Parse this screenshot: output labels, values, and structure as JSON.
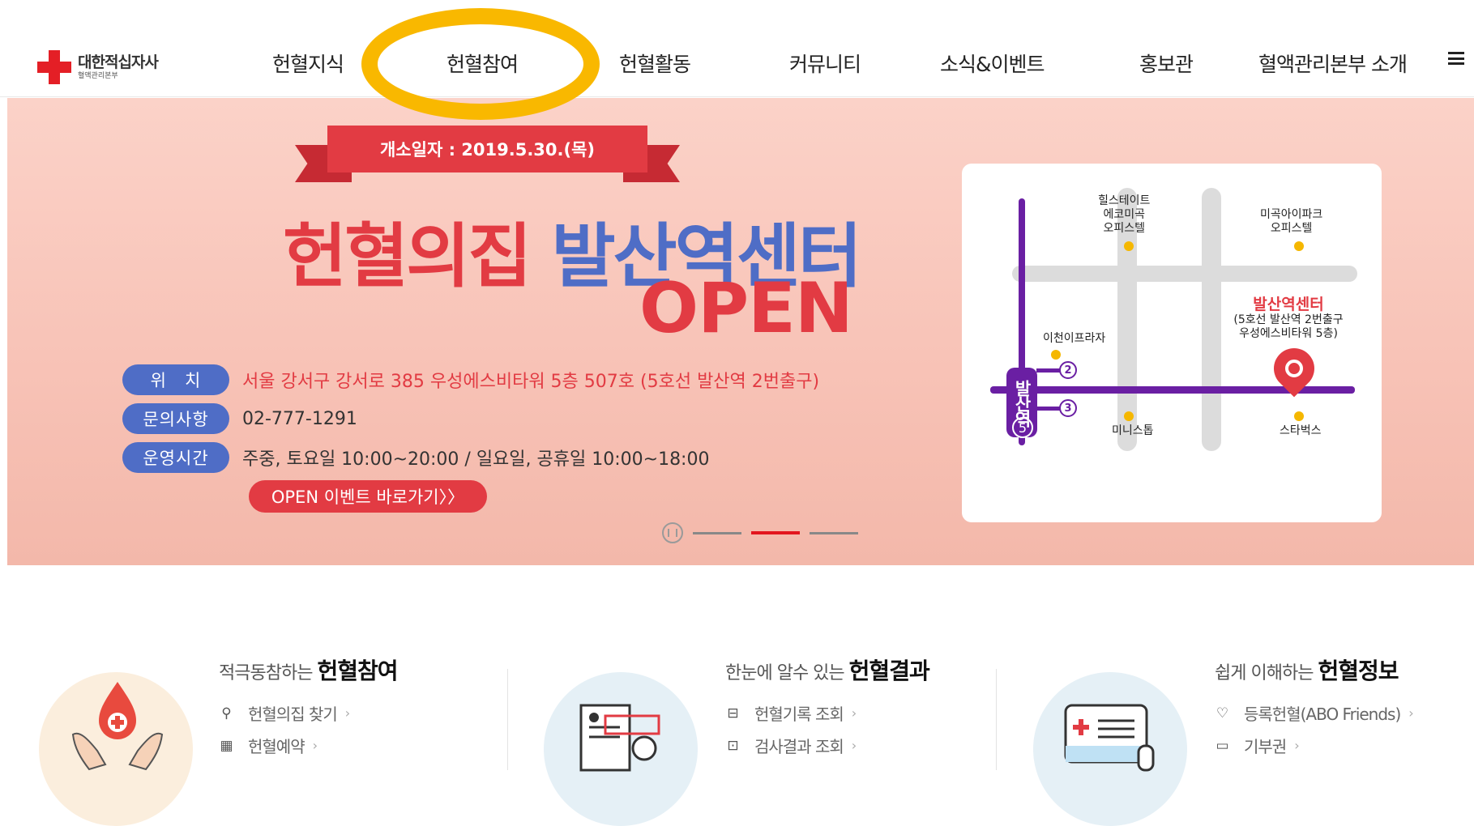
{
  "header": {
    "logo": {
      "main": "대한적십자사",
      "sub": "혈액관리본부"
    },
    "nav": [
      {
        "label": "헌혈지식"
      },
      {
        "label": "헌혈참여"
      },
      {
        "label": "헌혈활동"
      },
      {
        "label": "커뮤니티"
      },
      {
        "label": "소식&이벤트"
      },
      {
        "label": "홍보관"
      },
      {
        "label": "혈액관리본부 소개"
      }
    ],
    "highlighted_nav": "헌혈참여",
    "highlight_color": "#f9b800"
  },
  "banner": {
    "ribbon": "개소일자 : 2019.5.30.(목)",
    "headline_red": "헌혈의집",
    "headline_blue": "발산역센터",
    "open": "OPEN",
    "info": [
      {
        "label": "위　치",
        "value": "서울 강서구 강서로 385 우성에스비타워 5층 507호 (5호선 발산역 2번출구)"
      },
      {
        "label": "문의사항",
        "value": "02-777-1291"
      },
      {
        "label": "운영시간",
        "value": "주중, 토요일 10:00~20:00 / 일요일, 공휴일 10:00~18:00"
      }
    ],
    "event_button": "OPEN 이벤트 바로가기〉〉",
    "slider": {
      "total": 3,
      "active": 2
    },
    "colors": {
      "red": "#e23b43",
      "blue": "#4f6dc6",
      "metro": "#6a1fa3"
    },
    "map": {
      "pois": [
        {
          "label": "힐스테이트\n에코미곡\n오피스텔"
        },
        {
          "label": "미곡아이파크\n오피스텔"
        },
        {
          "label": "이천이프라자"
        },
        {
          "label": "미니스톱"
        },
        {
          "label": "스타벅스"
        }
      ],
      "center_title": "발산역센터",
      "center_sub": "(5호선 발산역 2번출구\n우성에스비타워 5층)",
      "station": "발산역",
      "line": "5",
      "exits": [
        "2",
        "3"
      ]
    }
  },
  "quick": [
    {
      "title_pre": "적극동참하는 ",
      "title_bold": "헌혈참여",
      "links": [
        {
          "icon": "location-pin-icon",
          "label": "헌혈의집 찾기"
        },
        {
          "icon": "building-icon",
          "label": "헌혈예약"
        }
      ]
    },
    {
      "title_pre": "한눈에 알수 있는 ",
      "title_bold": "헌혈결과",
      "links": [
        {
          "icon": "record-search-icon",
          "label": "헌혈기록 조회"
        },
        {
          "icon": "result-search-icon",
          "label": "검사결과 조회"
        }
      ]
    },
    {
      "title_pre": "쉽게 이해하는 ",
      "title_bold": "헌혈정보",
      "links": [
        {
          "icon": "heart-icon",
          "label": "등록헌혈(ABO Friends)"
        },
        {
          "icon": "card-icon",
          "label": "기부권"
        }
      ]
    }
  ]
}
